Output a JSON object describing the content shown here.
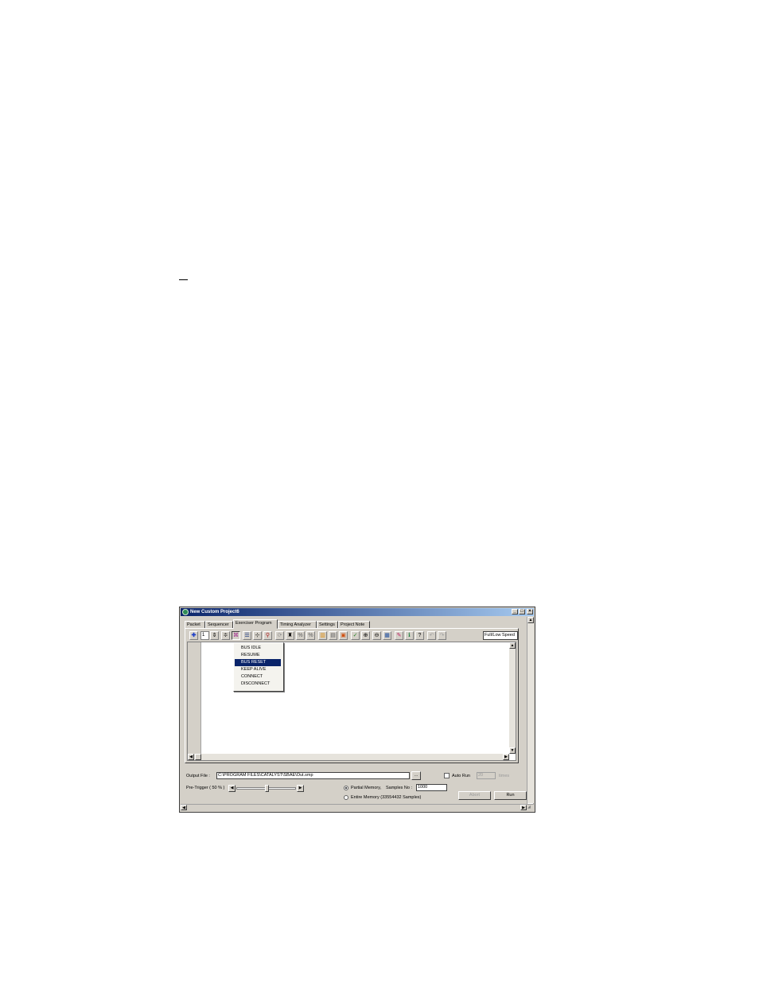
{
  "window": {
    "title": "New Custom Project6",
    "minimize": "_",
    "maximize": "□",
    "close": "×"
  },
  "tabs": [
    {
      "label": "Packet"
    },
    {
      "label": "Sequencer"
    },
    {
      "label": "Exerciser Program"
    },
    {
      "label": "Timing Analyzer"
    },
    {
      "label": "Settings"
    },
    {
      "label": "Project Note"
    }
  ],
  "toolbar": {
    "count_value": "1",
    "speed_value": "Full/Low Speed"
  },
  "context_menu": {
    "items": [
      {
        "label": "BUS IDLE"
      },
      {
        "label": "RESUME"
      },
      {
        "label": "BUS RESET"
      },
      {
        "label": "KEEP ALIVE"
      },
      {
        "label": "CONNECT"
      },
      {
        "label": "DISCONNECT"
      }
    ],
    "selected": "BUS RESET"
  },
  "bottom": {
    "output_file_label": "Output File :",
    "output_file_value": "C:\\PROGRAM FILES\\CATALYST\\SBAE\\Out.smp",
    "browse_label": "...",
    "auto_run_label": "Auto Run",
    "auto_run_value": "20",
    "times_label": "times",
    "pre_trigger_label": "Pre-Trigger ( 50 % )",
    "partial_memory_label": "Partial Memory,",
    "samples_no_label": "Samples No :",
    "samples_no_value": "1000",
    "entire_memory_label": "Entire Memory (33554432 Samples)",
    "abort_label": "Abort",
    "run_label": "Run"
  },
  "colors": {
    "title_start": "#0a246a",
    "title_end": "#a6caf0",
    "face": "#d4d0c8",
    "selection": "#0a246a"
  }
}
